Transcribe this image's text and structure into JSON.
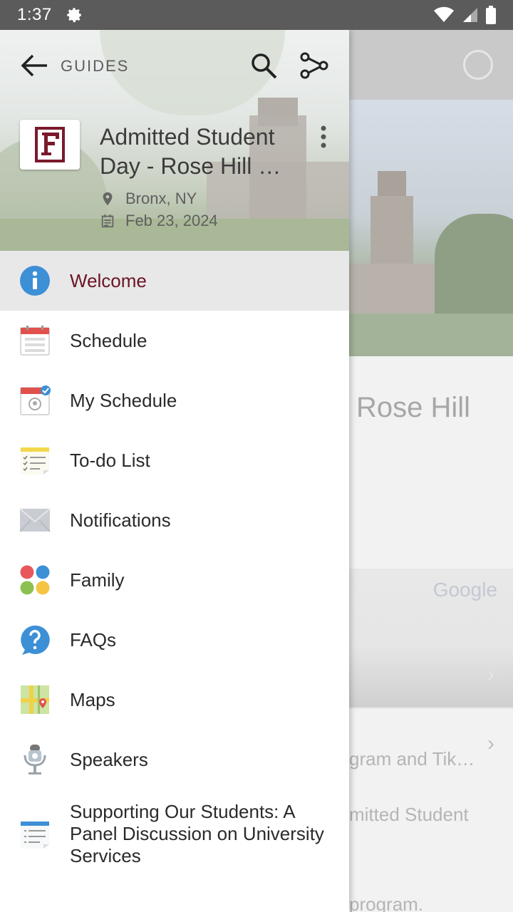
{
  "status_bar": {
    "time": "1:37"
  },
  "background": {
    "title_fragment": "Rose Hill",
    "map_brand": "Google",
    "row1_text": "gram and Tik…",
    "row2_text": "mitted Student",
    "row3_text": "program."
  },
  "drawer": {
    "header": {
      "section_label": "GUIDES",
      "logo_letter": "F",
      "guide_title": "Admitted Student Day - Rose Hill …",
      "location": "Bronx, NY",
      "date": "Feb 23, 2024"
    },
    "menu": [
      {
        "label": "Welcome",
        "icon": "info-icon",
        "active": true
      },
      {
        "label": "Schedule",
        "icon": "calendar-icon"
      },
      {
        "label": "My Schedule",
        "icon": "my-schedule-icon"
      },
      {
        "label": "To-do List",
        "icon": "todo-list-icon"
      },
      {
        "label": "Notifications",
        "icon": "envelope-icon"
      },
      {
        "label": "Family",
        "icon": "four-dots-icon"
      },
      {
        "label": "FAQs",
        "icon": "question-bubble-icon"
      },
      {
        "label": "Maps",
        "icon": "map-icon"
      },
      {
        "label": "Speakers",
        "icon": "microphone-icon"
      },
      {
        "label": "Supporting Our Students: A Panel Discussion on University Services",
        "icon": "document-list-icon"
      }
    ]
  },
  "colors": {
    "active_label": "#6b1424",
    "brand_maroon": "#7a1a2c",
    "status_bar": "#5b5b5b"
  }
}
